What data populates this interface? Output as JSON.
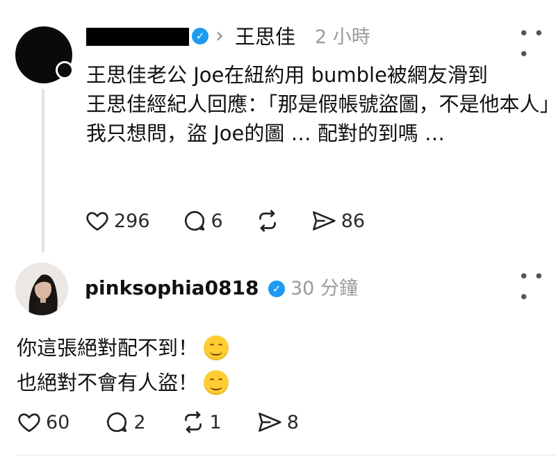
{
  "post": {
    "repost_name": "王思佳",
    "time": "2 小時",
    "lines": [
      "王思佳老公 Joe在紐約用 bumble被網友滑到",
      "王思佳經紀人回應：「那是假帳號盜圖，不是他本人」",
      "我只想問，盜 Joe的圖 … 配對的到嗎 …"
    ],
    "likes": "296",
    "comments": "6",
    "shares": "86"
  },
  "reply": {
    "username": "pinksophia0818",
    "time": "30 分鐘",
    "line1": "你這張絕對配不到！",
    "line2": "也絕對不會有人盜！",
    "likes": "60",
    "comments": "2",
    "reposts": "1",
    "shares": "8"
  },
  "icons": {
    "more": "more-horizontal-icon",
    "verified": "verified-badge-icon",
    "like": "heart-icon",
    "comment": "comment-bubble-icon",
    "repost": "repost-icon",
    "share": "send-icon",
    "emoji": "smiling-face-emoji"
  },
  "colors": {
    "verified": "#1d9bf0",
    "muted": "#9a9a9a"
  }
}
